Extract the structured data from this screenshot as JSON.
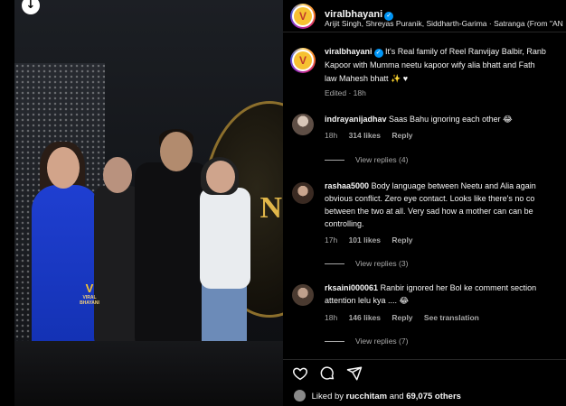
{
  "header": {
    "username": "viralbhayani",
    "audio": "Arijit Singh, Shreyas Puranik, Siddharth-Garima · Satranga (From \"AN"
  },
  "caption": {
    "username": "viralbhayani",
    "line1": "It's Real family of Reel Ranvijay Balbir, Ranb",
    "line2": "Kapoor with Mumma neetu kapoor wify alia bhatt and Fath",
    "line3": "law Mahesh bhatt ✨ ♥",
    "meta": "Edited · 18h"
  },
  "comments": [
    {
      "username": "indrayanijadhav",
      "lines": [
        "Saas Bahu ignoring each other 😂"
      ],
      "time": "18h",
      "likes": "314 likes",
      "reply": "Reply",
      "replies": "View replies (4)"
    },
    {
      "username": "rashaa5000",
      "lines": [
        "Body language between Neetu and Alia again",
        "obvious conflict. Zero eye contact. Looks like there's no co",
        "between the two at all. Very sad how a mother can can be",
        "controlling."
      ],
      "time": "17h",
      "likes": "101 likes",
      "reply": "Reply",
      "replies": "View replies (3)"
    },
    {
      "username": "rksaini000061",
      "lines": [
        "Ranbir ignored her Bol ke comment section",
        "attention lelu kya .... 😂"
      ],
      "time": "18h",
      "likes": "146 likes",
      "reply": "Reply",
      "translate": "See translation",
      "replies": "View replies (7)"
    }
  ],
  "likes": {
    "prefix": "Liked by",
    "user": "rucchitam",
    "conj": "and",
    "others": "69,075 others"
  },
  "media": {
    "watermark_small": "VIRAL BHAYANI",
    "watermark_logo": "V",
    "backdrop_text": "N"
  },
  "icons": {
    "down": "arrow-down-circle-icon",
    "like": "heart-icon",
    "comment": "comment-icon",
    "share": "paper-plane-icon",
    "verified": "verified-badge-icon"
  },
  "colors": {
    "verified": "#0095f6",
    "muted": "#a8a8a8",
    "heart": "#ff3040"
  }
}
